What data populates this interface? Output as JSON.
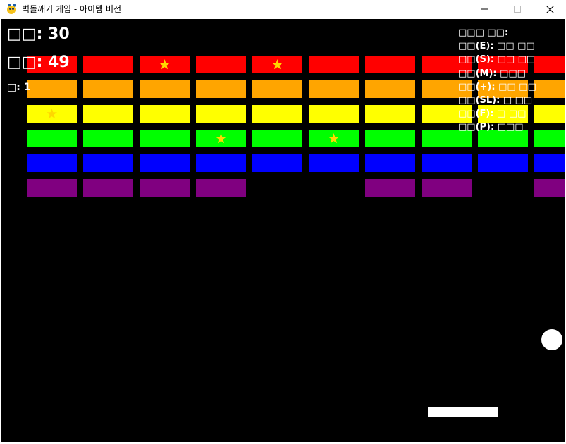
{
  "window": {
    "title": "벽돌깨기 게임 - 아이템 버전",
    "app_icon": "pygame-snake-icon",
    "controls": [
      "minimize-icon",
      "maximize-icon",
      "close-icon"
    ]
  },
  "hud": {
    "score_label": "□□: 30",
    "bricks_label": "□□: 49",
    "lives_label": "□: 1"
  },
  "legend": {
    "title": "□□□ □□:",
    "items": [
      "□□(E): □□ □□",
      "□□(S): □□ □□",
      "□□(M): □□□",
      "□□(+): □□ □□",
      "□□(SL): □ □□",
      "□□(F): □ □□",
      "□□(P): □□□"
    ]
  },
  "colors": {
    "rows": [
      "#ff0000",
      "#ffa500",
      "#ffff00",
      "#00ff00",
      "#0000ff",
      "#800080"
    ],
    "star": "#ffd700",
    "background": "#000000"
  },
  "bricks": {
    "columns": 10,
    "rows": [
      {
        "present": [
          true,
          true,
          true,
          true,
          true,
          true,
          true,
          true,
          true,
          true
        ],
        "stars": [
          2,
          4
        ]
      },
      {
        "present": [
          true,
          true,
          true,
          true,
          true,
          true,
          true,
          true,
          true,
          true
        ],
        "stars": []
      },
      {
        "present": [
          true,
          true,
          true,
          true,
          true,
          true,
          true,
          true,
          true,
          true
        ],
        "stars": [
          0
        ]
      },
      {
        "present": [
          true,
          true,
          true,
          true,
          true,
          true,
          true,
          true,
          true,
          true
        ],
        "stars": [
          3,
          5
        ]
      },
      {
        "present": [
          true,
          true,
          true,
          true,
          true,
          true,
          true,
          true,
          true,
          true
        ],
        "stars": []
      },
      {
        "present": [
          true,
          true,
          true,
          true,
          false,
          false,
          true,
          true,
          false,
          true
        ],
        "stars": []
      }
    ]
  }
}
